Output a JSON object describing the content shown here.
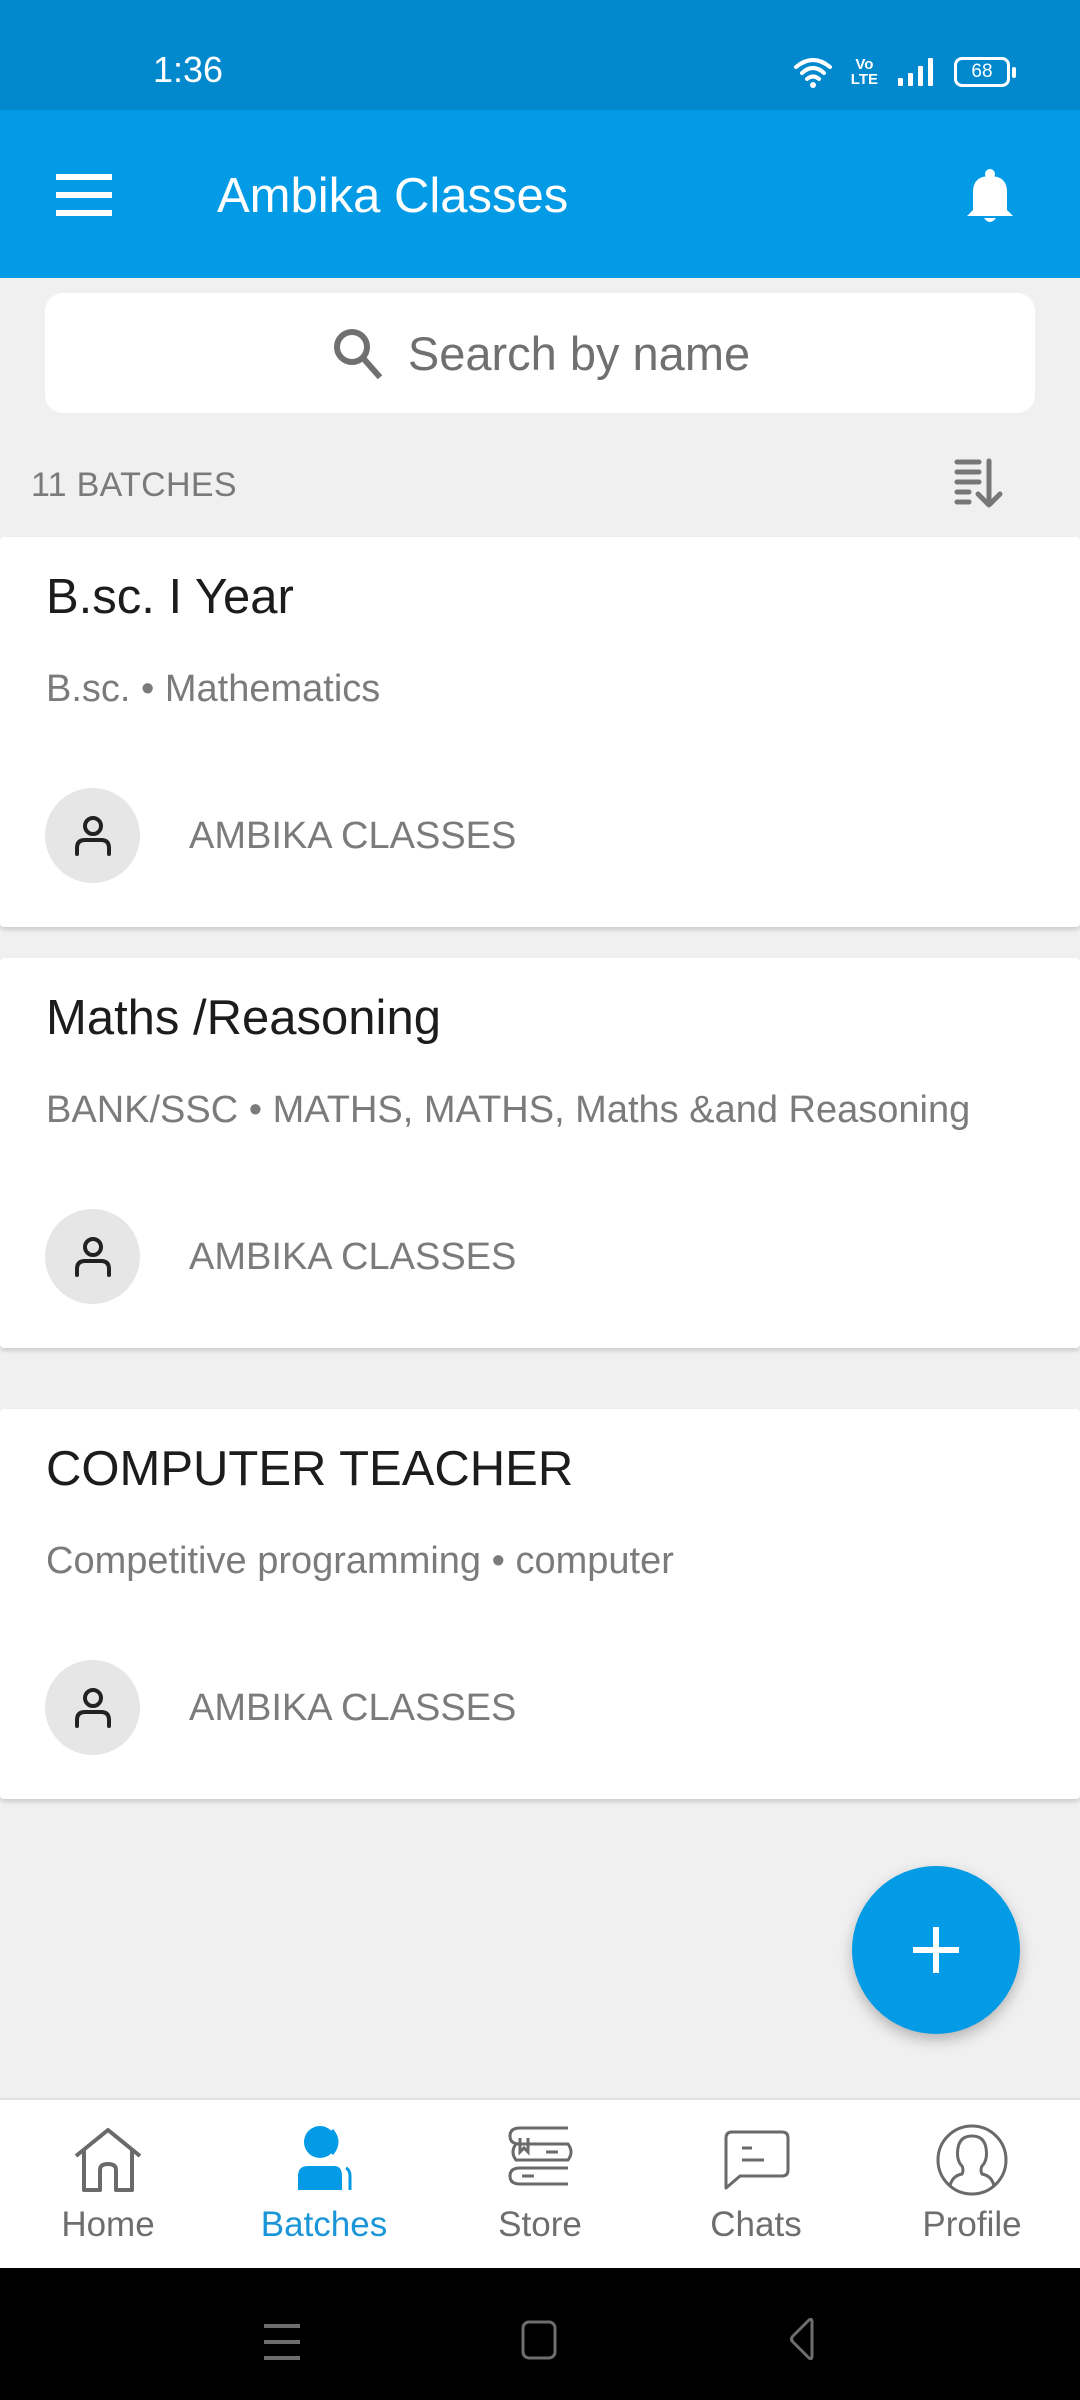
{
  "status_bar": {
    "time": "1:36",
    "network_label_top": "Vo",
    "network_label_bottom": "LTE",
    "battery": "68"
  },
  "app_bar": {
    "title": "Ambika Classes",
    "menu_icon": "hamburger-menu-icon",
    "notification_icon": "bell-icon"
  },
  "search": {
    "placeholder": "Search by name",
    "icon": "search-icon"
  },
  "list_header": {
    "count_label": "11 BATCHES",
    "sort_icon": "sort-descending-icon"
  },
  "batches": [
    {
      "title": "B.sc. I Year",
      "subtitle": "B.sc.  • Mathematics",
      "owner": "AMBIKA CLASSES"
    },
    {
      "title": "Maths /Reasoning",
      "subtitle": "BANK/SSC • MATHS, MATHS, Maths &and Reasoning",
      "owner": "AMBIKA CLASSES"
    },
    {
      "title": "COMPUTER TEACHER",
      "subtitle": "Competitive programming • computer",
      "owner": "AMBIKA CLASSES"
    }
  ],
  "fab": {
    "icon": "plus-icon"
  },
  "bottom_nav": {
    "items": [
      {
        "label": "Home",
        "icon": "home-icon",
        "active": false
      },
      {
        "label": "Batches",
        "icon": "batches-icon",
        "active": true
      },
      {
        "label": "Store",
        "icon": "books-icon",
        "active": false
      },
      {
        "label": "Chats",
        "icon": "chat-icon",
        "active": false
      },
      {
        "label": "Profile",
        "icon": "profile-icon",
        "active": false
      }
    ]
  },
  "colors": {
    "primary": "#039be5",
    "status_bar": "#0288cc",
    "active_tab": "#1a95d8",
    "background": "#f0f0f0"
  }
}
